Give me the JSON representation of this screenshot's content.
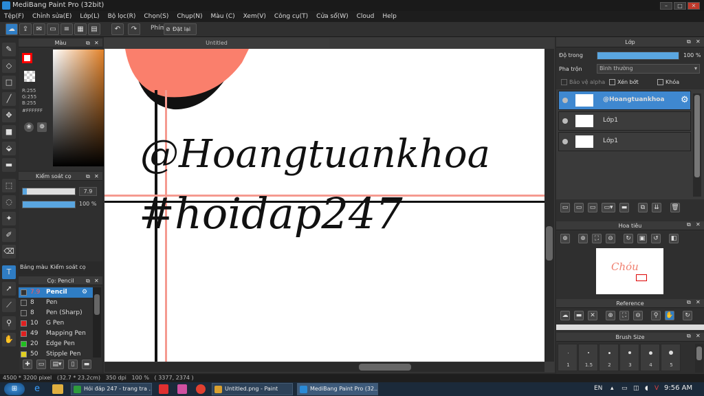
{
  "window": {
    "title": "MediBang Paint Pro (32bit)"
  },
  "menu": [
    "Tệp(F)",
    "Chỉnh sửa(E)",
    "Lớp(L)",
    "Bộ lọc(R)",
    "Chọn(S)",
    "Chụp(N)",
    "Màu (C)",
    "Xem(V)",
    "Công cụ(T)",
    "Cửa sổ(W)",
    "Cloud",
    "Help"
  ],
  "toolbar": {
    "shortcut_label": "Phím",
    "reset_label": "Đặt lại"
  },
  "color_panel": {
    "title": "Màu",
    "r": "R:255",
    "g": "G:255",
    "b": "B:255",
    "hex": "#FFFFFF",
    "primary_color": "#ff0000",
    "secondary_color": "#ffffff"
  },
  "brush_control": {
    "title": "Kiểm soát cọ",
    "size": "7.9",
    "opacity": "100 %",
    "opacity_fraction": 1.0,
    "size_fraction": 0.08
  },
  "palette_tabs": [
    "Bảng màu",
    "Kiểm soát cọ"
  ],
  "brush_panel": {
    "title": "Cọ: Pencil",
    "brushes": [
      {
        "size": "7.9",
        "name": "Pencil",
        "color": "#333333",
        "selected": true
      },
      {
        "size": "8",
        "name": "Pen",
        "color": "#333333"
      },
      {
        "size": "8",
        "name": "Pen (Sharp)",
        "color": "#333333"
      },
      {
        "size": "10",
        "name": "G Pen",
        "color": "#e02020"
      },
      {
        "size": "49",
        "name": "Mapping Pen",
        "color": "#e02020"
      },
      {
        "size": "20",
        "name": "Edge Pen",
        "color": "#20c020"
      },
      {
        "size": "50",
        "name": "Stipple Pen",
        "color": "#e0d020"
      }
    ]
  },
  "document": {
    "tab_title": "Untitled",
    "text_line1": "@Hoangtuankhoa",
    "text_line2": "#hoidap247"
  },
  "layer_panel": {
    "title": "Lớp",
    "opacity_label": "Độ trong",
    "opacity_value": "100 %",
    "blend_label": "Pha trộn",
    "blend_value": "Bình thường",
    "protect_alpha": "Bảo vệ alpha",
    "clipping": "Xén bớt",
    "lock": "Khóa",
    "layers": [
      {
        "name": "@Hoangtuankhoa",
        "selected": true
      },
      {
        "name": "Lớp1"
      },
      {
        "name": "Lớp1"
      }
    ]
  },
  "navigator": {
    "title": "Hoa tiêu"
  },
  "reference": {
    "title": "Reference"
  },
  "brush_size": {
    "title": "Brush Size",
    "sizes": [
      "1",
      "1.5",
      "2",
      "3",
      "4",
      "5"
    ]
  },
  "status": {
    "text": "4500 * 3200 pixel   (32.7 * 23.2cm)   350 dpi   100 %   ( 3377, 2374 )"
  },
  "taskbar": {
    "items": [
      {
        "label": "Hỏi đáp 247 - trang tra ...",
        "color": "#2e9b3c"
      },
      {
        "label": "Untitled.png - Paint",
        "color": "#d8a030"
      },
      {
        "label": "MediBang Paint Pro (32...",
        "color": "#2a8ad6"
      }
    ],
    "lang": "EN",
    "time": "9:56 AM"
  }
}
